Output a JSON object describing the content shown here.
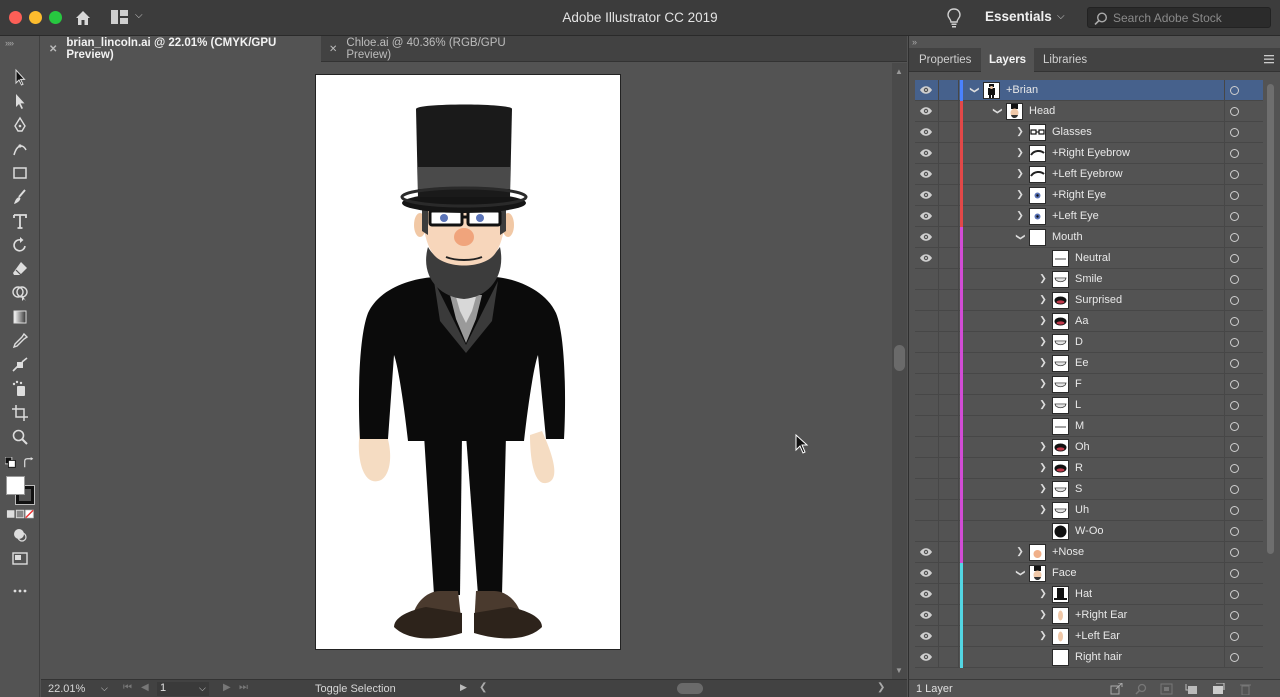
{
  "app": {
    "title": "Adobe Illustrator CC 2019",
    "workspace": "Essentials",
    "search_placeholder": "Search Adobe Stock"
  },
  "document_tabs": [
    {
      "label": "brian_lincoln.ai @ 22.01% (CMYK/GPU Preview)",
      "active": true
    },
    {
      "label": "Chloe.ai @ 40.36% (RGB/GPU Preview)",
      "active": false
    }
  ],
  "tools": [
    "selection-tool-icon",
    "direct-selection-tool-icon",
    "pen-tool-icon",
    "curvature-tool-icon",
    "rectangle-tool-icon",
    "paintbrush-tool-icon",
    "type-tool-icon",
    "rotate-tool-icon",
    "eraser-tool-icon",
    "shape-builder-tool-icon",
    "gradient-tool-icon",
    "eyedropper-tool-icon",
    "blend-tool-icon",
    "symbol-sprayer-tool-icon",
    "artboard-tool-icon",
    "zoom-tool-icon"
  ],
  "status": {
    "zoom": "22.01%",
    "page": "1",
    "text": "Toggle Selection"
  },
  "panel": {
    "tabs": [
      "Properties",
      "Layers",
      "Libraries"
    ],
    "active_tab": "Layers",
    "footer_count": "1 Layer",
    "colors": {
      "blue": "#4a82ff",
      "red": "#e24848",
      "magenta": "#d24cd6",
      "cyan": "#53d6e3"
    }
  },
  "layers": [
    {
      "name": "+Brian",
      "indent": 0,
      "chevron": "open",
      "visible": true,
      "color": "blue",
      "selected": true,
      "thumb": "figure"
    },
    {
      "name": "Head",
      "indent": 1,
      "chevron": "open",
      "visible": true,
      "color": "red",
      "thumb": "head"
    },
    {
      "name": "Glasses",
      "indent": 2,
      "chevron": "closed",
      "visible": true,
      "color": "red",
      "thumb": "glasses"
    },
    {
      "name": "+Right Eyebrow",
      "indent": 2,
      "chevron": "closed",
      "visible": true,
      "color": "red",
      "thumb": "brow"
    },
    {
      "name": "+Left Eyebrow",
      "indent": 2,
      "chevron": "closed",
      "visible": true,
      "color": "red",
      "thumb": "brow"
    },
    {
      "name": "+Right Eye",
      "indent": 2,
      "chevron": "closed",
      "visible": true,
      "color": "red",
      "thumb": "eye"
    },
    {
      "name": "+Left Eye",
      "indent": 2,
      "chevron": "closed",
      "visible": true,
      "color": "red",
      "thumb": "eye"
    },
    {
      "name": "Mouth",
      "indent": 2,
      "chevron": "open",
      "visible": true,
      "color": "magenta",
      "thumb": "blank"
    },
    {
      "name": "Neutral",
      "indent": 3,
      "chevron": "none",
      "visible": true,
      "color": "magenta",
      "thumb": "line"
    },
    {
      "name": "Smile",
      "indent": 3,
      "chevron": "closed",
      "visible": false,
      "color": "magenta",
      "thumb": "smile"
    },
    {
      "name": "Surprised",
      "indent": 3,
      "chevron": "closed",
      "visible": false,
      "color": "magenta",
      "thumb": "open"
    },
    {
      "name": "Aa",
      "indent": 3,
      "chevron": "closed",
      "visible": false,
      "color": "magenta",
      "thumb": "open"
    },
    {
      "name": "D",
      "indent": 3,
      "chevron": "closed",
      "visible": false,
      "color": "magenta",
      "thumb": "smile"
    },
    {
      "name": "Ee",
      "indent": 3,
      "chevron": "closed",
      "visible": false,
      "color": "magenta",
      "thumb": "smile"
    },
    {
      "name": "F",
      "indent": 3,
      "chevron": "closed",
      "visible": false,
      "color": "magenta",
      "thumb": "smile"
    },
    {
      "name": "L",
      "indent": 3,
      "chevron": "closed",
      "visible": false,
      "color": "magenta",
      "thumb": "smile"
    },
    {
      "name": "M",
      "indent": 3,
      "chevron": "none",
      "visible": false,
      "color": "magenta",
      "thumb": "line"
    },
    {
      "name": "Oh",
      "indent": 3,
      "chevron": "closed",
      "visible": false,
      "color": "magenta",
      "thumb": "open"
    },
    {
      "name": "R",
      "indent": 3,
      "chevron": "closed",
      "visible": false,
      "color": "magenta",
      "thumb": "open"
    },
    {
      "name": "S",
      "indent": 3,
      "chevron": "closed",
      "visible": false,
      "color": "magenta",
      "thumb": "smile"
    },
    {
      "name": "Uh",
      "indent": 3,
      "chevron": "closed",
      "visible": false,
      "color": "magenta",
      "thumb": "smile"
    },
    {
      "name": "W-Oo",
      "indent": 3,
      "chevron": "none",
      "visible": false,
      "color": "magenta",
      "thumb": "dot"
    },
    {
      "name": "+Nose",
      "indent": 2,
      "chevron": "closed",
      "visible": true,
      "color": "magenta",
      "thumb": "nose"
    },
    {
      "name": "Face",
      "indent": 2,
      "chevron": "open",
      "visible": true,
      "color": "cyan",
      "thumb": "head"
    },
    {
      "name": "Hat",
      "indent": 3,
      "chevron": "closed",
      "visible": true,
      "color": "cyan",
      "thumb": "hat"
    },
    {
      "name": "+Right Ear",
      "indent": 3,
      "chevron": "closed",
      "visible": true,
      "color": "cyan",
      "thumb": "ear"
    },
    {
      "name": "+Left Ear",
      "indent": 3,
      "chevron": "closed",
      "visible": true,
      "color": "cyan",
      "thumb": "ear"
    },
    {
      "name": "Right hair",
      "indent": 3,
      "chevron": "none",
      "visible": true,
      "color": "cyan",
      "thumb": "blank"
    }
  ]
}
